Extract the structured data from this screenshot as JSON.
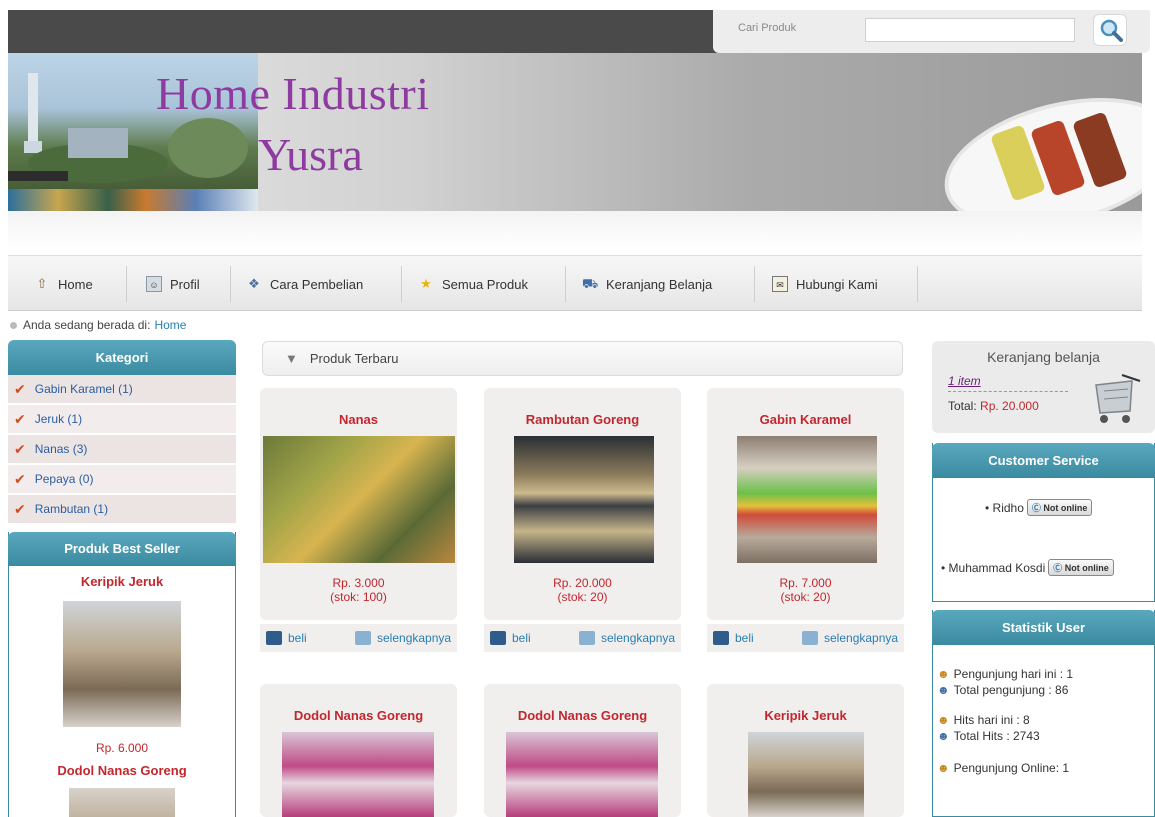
{
  "search": {
    "label": "Cari Produk",
    "value": ""
  },
  "header": {
    "title_line1": "Home Industri",
    "title_line2": "Yusra"
  },
  "nav": [
    {
      "label": "Home",
      "icon": "home-icon"
    },
    {
      "label": "Profil",
      "icon": "profile-icon"
    },
    {
      "label": "Cara Pembelian",
      "icon": "help-icon"
    },
    {
      "label": "Semua Produk",
      "icon": "star-icon"
    },
    {
      "label": "Keranjang Belanja",
      "icon": "car-icon"
    },
    {
      "label": "Hubungi Kami",
      "icon": "contact-icon"
    }
  ],
  "breadcrumb": {
    "prefix": "Anda sedang berada di:",
    "current": "Home"
  },
  "kategori": {
    "title": "Kategori",
    "items": [
      "Gabin Karamel (1)",
      "Jeruk (1)",
      "Nanas (3)",
      "Pepaya (0)",
      "Rambutan (1)"
    ]
  },
  "best_seller": {
    "title": "Produk Best Seller",
    "items": [
      {
        "name": "Keripik Jeruk",
        "price": "Rp. 6.000"
      },
      {
        "name": "Dodol Nanas Goreng"
      }
    ]
  },
  "center": {
    "title": "Produk Terbaru",
    "buy_label": "beli",
    "more_label": "selengkapnya",
    "products": [
      {
        "name": "Nanas",
        "price": "Rp. 3.000",
        "stock": "(stok: 100)"
      },
      {
        "name": "Rambutan Goreng",
        "price": "Rp. 20.000",
        "stock": "(stok: 20)"
      },
      {
        "name": "Gabin Karamel",
        "price": "Rp. 7.000",
        "stock": "(stok: 20)"
      },
      {
        "name": "Dodol Nanas Goreng"
      },
      {
        "name": "Dodol Nanas Goreng"
      },
      {
        "name": "Keripik Jeruk"
      }
    ]
  },
  "cart": {
    "title": "Keranjang belanja",
    "items": "1 item",
    "total_label": "Total:",
    "total_value": "Rp. 20.000"
  },
  "customer_service": {
    "title": "Customer Service",
    "agents": [
      {
        "name": "• Ridho",
        "status": "Not online"
      },
      {
        "name": "• Muhammad Kosdi",
        "status": "Not online"
      }
    ]
  },
  "statistik": {
    "title": "Statistik User",
    "lines": [
      "Pengunjung hari ini : 1",
      "Total pengunjung : 86",
      "Hits hari ini : 8",
      "Total Hits : 2743",
      "Pengunjung Online: 1"
    ]
  }
}
